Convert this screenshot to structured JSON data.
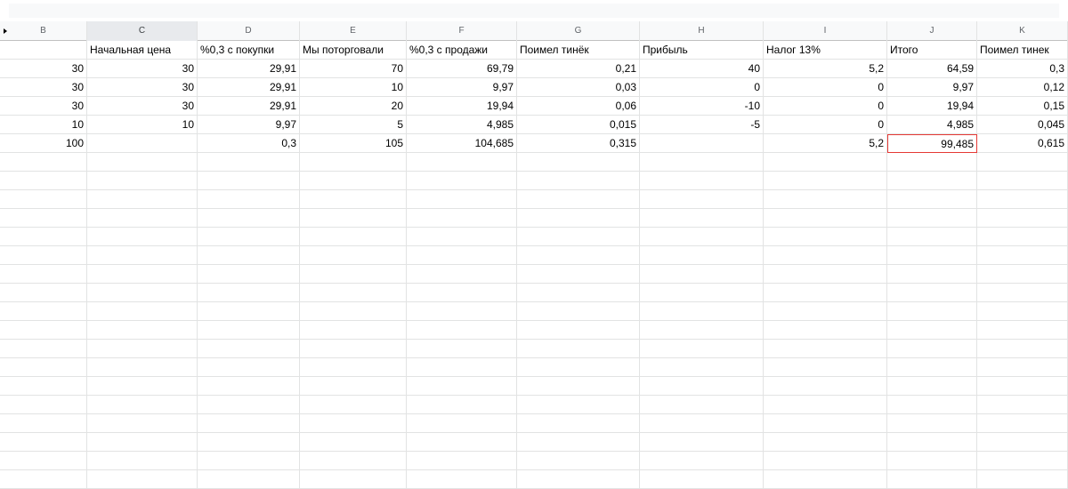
{
  "columns": [
    "B",
    "C",
    "D",
    "E",
    "F",
    "G",
    "H",
    "I",
    "J",
    "K"
  ],
  "header_row": [
    "",
    "Начальная цена",
    "%0,3 с покупки",
    "Мы поторговали",
    "%0,3 с продажи",
    "Поимел тинёк",
    "Прибыль",
    "Налог 13%",
    "Итого",
    "Поимел тинек"
  ],
  "rows": [
    [
      "30",
      "30",
      "29,91",
      "70",
      "69,79",
      "0,21",
      "40",
      "5,2",
      "64,59",
      "0,3"
    ],
    [
      "30",
      "30",
      "29,91",
      "10",
      "9,97",
      "0,03",
      "0",
      "0",
      "9,97",
      "0,12"
    ],
    [
      "30",
      "30",
      "29,91",
      "20",
      "19,94",
      "0,06",
      "-10",
      "0",
      "19,94",
      "0,15"
    ],
    [
      "10",
      "10",
      "9,97",
      "5",
      "4,985",
      "0,015",
      "-5",
      "0",
      "4,985",
      "0,045"
    ],
    [
      "100",
      "",
      "0,3",
      "105",
      "104,685",
      "0,315",
      "",
      "5,2",
      "99,485",
      "0,615"
    ]
  ],
  "selected_column": "C",
  "active_cell": "J-row5",
  "active_cell_color": "#e53935"
}
